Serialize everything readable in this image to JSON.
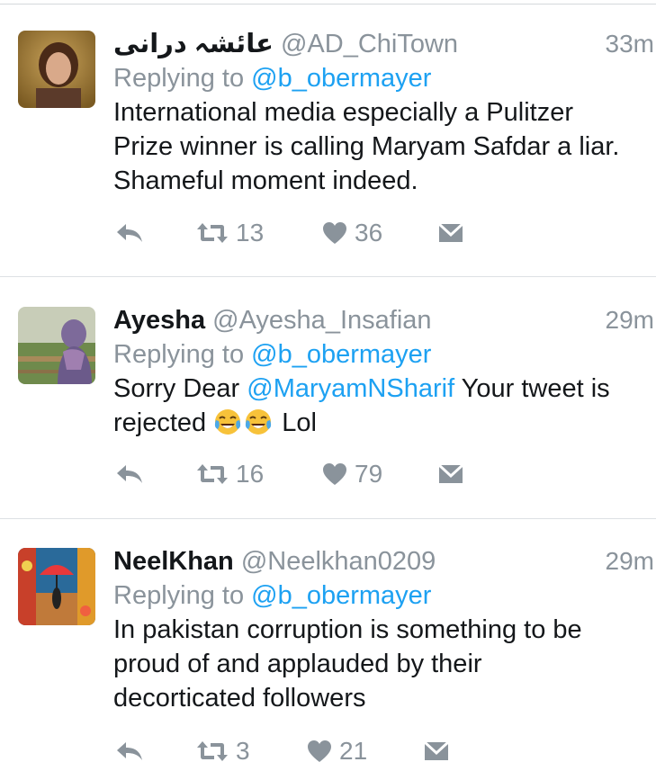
{
  "tweets": [
    {
      "name": "عائشہ درانی",
      "handle": "@AD_ChiTown",
      "time": "33m",
      "replying_label": "Replying to",
      "replying_to": "@b_obermayer",
      "text_lines": [
        "International media especially a Pulitzer",
        "Prize winner is calling Maryam Safdar a liar.",
        "Shameful moment indeed."
      ],
      "retweets": "13",
      "likes": "36"
    },
    {
      "name": "Ayesha",
      "handle": "@Ayesha_Insafian",
      "time": "29m",
      "replying_label": "Replying to",
      "replying_to": "@b_obermayer",
      "text_prefix": "Sorry Dear ",
      "text_mention": "@MaryamNSharif",
      "text_suffix": " Your tweet is",
      "text_line2_start": "rejected ",
      "text_line2_end": " Lol",
      "emoji_name": "face-with-tears-of-joy",
      "retweets": "16",
      "likes": "79"
    },
    {
      "name": "NeelKhan",
      "handle": "@Neelkhan0209",
      "time": "29m",
      "replying_label": "Replying to",
      "replying_to": "@b_obermayer",
      "text_lines": [
        "In pakistan corruption is something to be",
        "proud of and applauded by their",
        "decorticated followers"
      ],
      "retweets": "3",
      "likes": "21"
    }
  ],
  "icons": [
    "reply-icon",
    "retweet-icon",
    "heart-icon",
    "direct-message-icon"
  ],
  "colors": {
    "text": "#14171a",
    "muted": "#8a939b",
    "link": "#1da1f2",
    "icon": "#8a939b",
    "divider": "#dde1e4"
  }
}
